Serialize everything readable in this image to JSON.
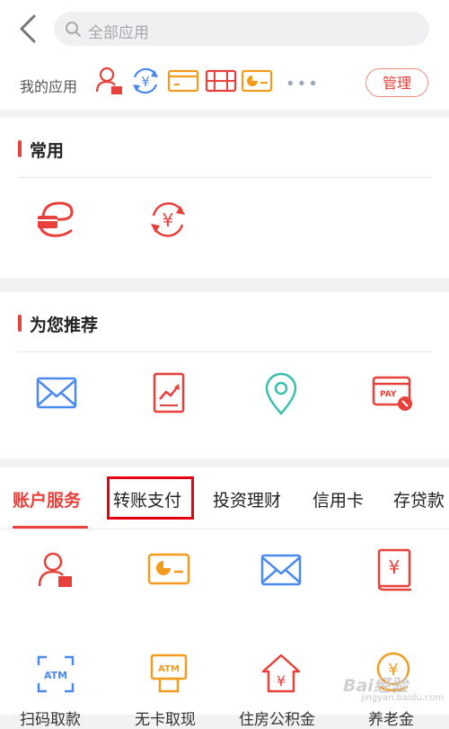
{
  "header": {
    "search_placeholder": "全部应用",
    "my_apps_label": "我的应用",
    "more_dots": "•••",
    "manage_label": "管理",
    "my_apps_icons": [
      "user-account-icon",
      "yuan-exchange-icon",
      "card-icon",
      "calculator-icon",
      "chart-card-icon"
    ]
  },
  "sections": {
    "common": {
      "title": "常用",
      "icons": [
        "e-card-icon",
        "yuan-refresh-icon"
      ]
    },
    "recommend": {
      "title": "为您推荐",
      "icons": [
        "mail-icon",
        "trend-doc-icon",
        "location-pin-icon",
        "pay-card-icon"
      ]
    }
  },
  "tabs": [
    {
      "label": "账户服务",
      "active": true
    },
    {
      "label": "转账支付",
      "active": false,
      "highlighted": true
    },
    {
      "label": "投资理财",
      "active": false
    },
    {
      "label": "信用卡",
      "active": false
    },
    {
      "label": "存贷款",
      "active": false
    }
  ],
  "grid": {
    "row1_icons": [
      "user-account-icon",
      "chart-card-icon",
      "mail-icon",
      "yuan-document-icon"
    ],
    "row2": [
      {
        "icon": "atm-scan-icon",
        "label": "扫码取款"
      },
      {
        "icon": "atm-icon",
        "label": "无卡取现"
      },
      {
        "icon": "house-yuan-icon",
        "label": "住房公积金"
      },
      {
        "icon": "yuan-coin-icon",
        "label": "养老金"
      }
    ]
  },
  "watermark": {
    "text": "Bai经验",
    "sub": "jingyan.baidu.com"
  },
  "colors": {
    "accent": "#e8403a",
    "orange": "#f29b1d",
    "blue": "#4a8af0",
    "teal": "#3dbfaf"
  }
}
